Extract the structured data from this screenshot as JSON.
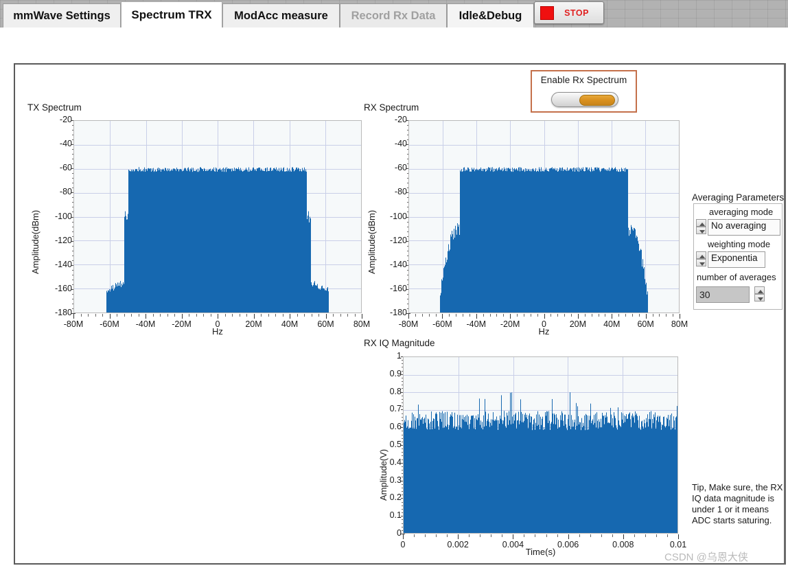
{
  "tabs": [
    {
      "label": "mmWave Settings",
      "state": "normal"
    },
    {
      "label": "Spectrum TRX",
      "state": "active"
    },
    {
      "label": "ModAcc measure",
      "state": "normal"
    },
    {
      "label": "Record Rx Data",
      "state": "disabled"
    },
    {
      "label": "Idle&Debug",
      "state": "light"
    }
  ],
  "stop_button": {
    "label": "STOP",
    "color": "#e02020",
    "indicator_color": "#f01010"
  },
  "enable_rx": {
    "label": "Enable Rx Spectrum",
    "state": "on",
    "border_color": "#c4704a",
    "knob_color": "#d9901f"
  },
  "averaging": {
    "group_title": "Averaging Parameters",
    "averaging_mode_label": "averaging mode",
    "averaging_mode_value": "No averaging",
    "weighting_mode_label": "weighting mode",
    "weighting_mode_value": "Exponentia",
    "number_of_averages_label": "number of averages",
    "number_of_averages_value": "30"
  },
  "tip": "Tip, Make sure, the RX IQ data magnitude is under 1 or it means ADC starts saturing.",
  "watermark": "CSDN @乌恩大侠",
  "colors": {
    "trace": "#1668b0",
    "grid": "#c9cfe8",
    "plot_bg": "#f6f9fa"
  },
  "chart_data": [
    {
      "type": "area",
      "name": "tx-spectrum",
      "title": "TX Spectrum",
      "xlabel": "Hz",
      "ylabel": "Amplitude(dBm)",
      "xlim": [
        -80000000,
        80000000
      ],
      "ylim": [
        -180,
        -20
      ],
      "xticks": [
        "-80M",
        "-60M",
        "-40M",
        "-20M",
        "0",
        "20M",
        "40M",
        "60M",
        "80M"
      ],
      "xtick_values": [
        -80000000,
        -60000000,
        -40000000,
        -20000000,
        0,
        20000000,
        40000000,
        60000000,
        80000000
      ],
      "yticks": [
        "-20",
        "-40",
        "-60",
        "-80",
        "-100",
        "-120",
        "-140",
        "-160",
        "-180"
      ],
      "ytick_values": [
        -20,
        -40,
        -60,
        -80,
        -100,
        -120,
        -140,
        -160,
        -180
      ],
      "grid": true,
      "legend": "none",
      "baseline": -180,
      "regions": [
        {
          "x_start": -80000000,
          "x_end": -62000000,
          "top": -180,
          "bottom": -180,
          "jitter": 0
        },
        {
          "x_start": -62000000,
          "x_end": -52000000,
          "top": -155,
          "bottom": -180,
          "jitter": 3
        },
        {
          "x_start": -52000000,
          "x_end": -50000000,
          "top": -100,
          "bottom": -180,
          "jitter": 5
        },
        {
          "x_start": -50000000,
          "x_end": 50000000,
          "top": -62,
          "bottom": -180,
          "jitter": 2,
          "floor_top": -112,
          "floor_jitter": 13
        },
        {
          "x_start": 50000000,
          "x_end": 52000000,
          "top": -100,
          "bottom": -180,
          "jitter": 5
        },
        {
          "x_start": 52000000,
          "x_end": 62000000,
          "top": -155,
          "bottom": -180,
          "jitter": 3
        },
        {
          "x_start": 62000000,
          "x_end": 80000000,
          "top": -180,
          "bottom": -180,
          "jitter": 0
        }
      ],
      "notes": "Main channel flat top at about -62 dBm from -50 MHz to +50 MHz; in-band noise pedestal near -112 dBm; out-of-band shoulders near -155 dBm between 52 and 62 MHz."
    },
    {
      "type": "area",
      "name": "rx-spectrum",
      "title": "RX Spectrum",
      "xlabel": "Hz",
      "ylabel": "Amplitude(dBm)",
      "xlim": [
        -80000000,
        80000000
      ],
      "ylim": [
        -180,
        -20
      ],
      "xticks": [
        "-80M",
        "-60M",
        "-40M",
        "-20M",
        "0",
        "20M",
        "40M",
        "60M",
        "80M"
      ],
      "xtick_values": [
        -80000000,
        -60000000,
        -40000000,
        -20000000,
        0,
        20000000,
        40000000,
        60000000,
        80000000
      ],
      "yticks": [
        "-20",
        "-40",
        "-60",
        "-80",
        "-100",
        "-120",
        "-140",
        "-160",
        "-180"
      ],
      "ytick_values": [
        -20,
        -40,
        -60,
        -80,
        -100,
        -120,
        -140,
        -160,
        -180
      ],
      "grid": true,
      "legend": "none",
      "baseline": -180,
      "regions": [
        {
          "x_start": -80000000,
          "x_end": -62000000,
          "top": -180,
          "bottom": -180,
          "jitter": 0
        },
        {
          "x_start": -62000000,
          "x_end": -50000000,
          "top": -110,
          "bottom": -180,
          "jitter": 6,
          "tail_bottom": -168
        },
        {
          "x_start": -50000000,
          "x_end": 50000000,
          "top": -62,
          "bottom": -180,
          "jitter": 2,
          "floor_top": -110,
          "floor_jitter": 14
        },
        {
          "x_start": 50000000,
          "x_end": 62000000,
          "top": -110,
          "bottom": -180,
          "jitter": 6,
          "tail_bottom": -168
        },
        {
          "x_start": 62000000,
          "x_end": 80000000,
          "top": -180,
          "bottom": -180,
          "jitter": 0
        }
      ],
      "notes": "Same occupied bandwidth as TX; sidebands at roughly -110 dBm extend from 50 to 62 MHz and fall to about -165 dBm at the outer edges."
    },
    {
      "type": "area",
      "name": "rx-iq-magnitude",
      "title": "RX IQ Magnitude",
      "xlabel": "Time(s)",
      "ylabel": "Amplitude(V)",
      "xlim": [
        0,
        0.01
      ],
      "ylim": [
        0,
        1
      ],
      "xticks": [
        "0",
        "0.002",
        "0.004",
        "0.006",
        "0.008",
        "0.01"
      ],
      "xtick_values": [
        0,
        0.002,
        0.004,
        0.006,
        0.008,
        0.01
      ],
      "yticks": [
        "1",
        "0.9",
        "0.8",
        "0.7",
        "0.6",
        "0.5",
        "0.4",
        "0.3",
        "0.2",
        "0.1",
        "0"
      ],
      "ytick_values": [
        1,
        0.9,
        0.8,
        0.7,
        0.6,
        0.5,
        0.4,
        0.3,
        0.2,
        0.1,
        0
      ],
      "grid": true,
      "legend": "none",
      "baseline": 0,
      "envelope_mean": 0.64,
      "envelope_min": 0.55,
      "envelope_max": 0.82,
      "notes": "Dense noise-like IQ magnitude filling from 0 V up to an envelope averaging about 0.64 V with occasional peaks reaching 0.81 V; stays under 1 V so the ADC is not saturating."
    }
  ]
}
